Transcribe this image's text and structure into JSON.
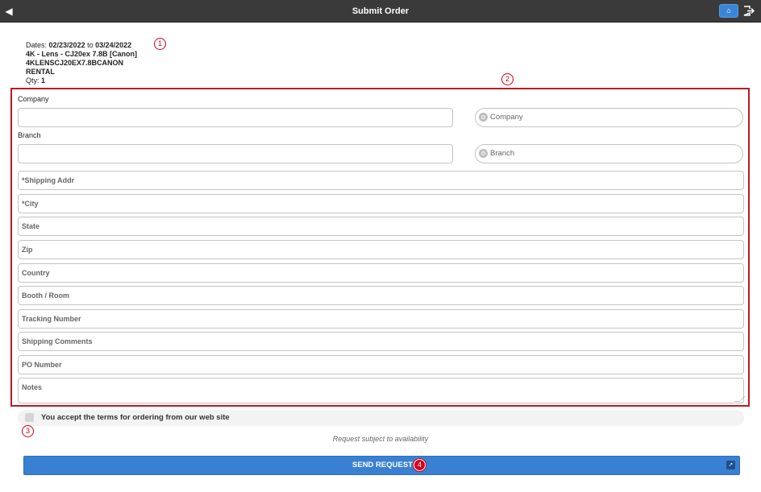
{
  "header": {
    "title": "Submit Order",
    "back_icon": "chevron-left-icon",
    "home_icon": "home-icon",
    "logout_icon": "logout-icon"
  },
  "markers": {
    "m1": "1",
    "m2": "2",
    "m3": "3",
    "m4": "4"
  },
  "order": {
    "dates_label": "Dates:",
    "start_date": "02/23/2022",
    "to": "to",
    "end_date": "03/24/2022",
    "product_name": "4K - Lens - CJ20ex 7.8B [Canon]",
    "product_code": "4KLENSCJ20EX7.8BCANON",
    "type": "RENTAL",
    "qty_label": "Qty:",
    "qty_value": "1"
  },
  "form": {
    "company_label": "Company",
    "company_value": "",
    "company_search_placeholder": "Company",
    "branch_label": "Branch",
    "branch_value": "",
    "branch_search_placeholder": "Branch",
    "fields": [
      {
        "placeholder": "*Shipping Addr",
        "value": ""
      },
      {
        "placeholder": "*City",
        "value": ""
      },
      {
        "placeholder": "State",
        "value": ""
      },
      {
        "placeholder": "Zip",
        "value": ""
      },
      {
        "placeholder": "Country",
        "value": ""
      },
      {
        "placeholder": "Booth / Room",
        "value": ""
      },
      {
        "placeholder": "Tracking Number",
        "value": ""
      },
      {
        "placeholder": "Shipping Comments",
        "value": ""
      },
      {
        "placeholder": "PO Number",
        "value": ""
      },
      {
        "placeholder": "Notes",
        "value": ""
      }
    ]
  },
  "terms": {
    "text": "You accept the terms for ordering from our web site",
    "checked": false
  },
  "availability_note": "Request subject to availability",
  "send_button": {
    "label": "SEND REQUEST",
    "icon": "external-icon"
  },
  "colors": {
    "accent": "#3a80d2",
    "header": "#3a3a3a",
    "highlight": "#b81c22"
  }
}
